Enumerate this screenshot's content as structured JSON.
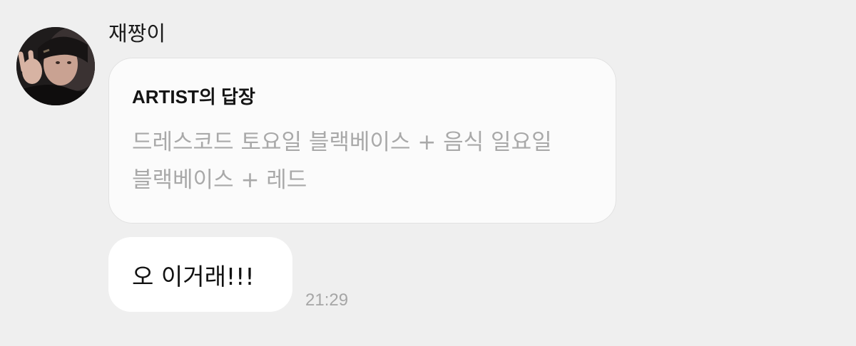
{
  "chat": {
    "sender_name": "재짱이",
    "avatar_icon": "user-avatar-photo",
    "reply": {
      "header": "ARTIST의 답장",
      "line1": "드레스코드 토요일 블랙베이스 + 음식 일요일",
      "line2": "블랙베이스 + 레드"
    },
    "message": {
      "text": "오 이거래!!!",
      "time": "21:29"
    }
  },
  "colors": {
    "background": "#efefef",
    "reply_card": "#fbfbfb",
    "bubble": "#ffffff",
    "muted_text": "#a9a9a9",
    "timestamp": "#a6a6a6"
  }
}
